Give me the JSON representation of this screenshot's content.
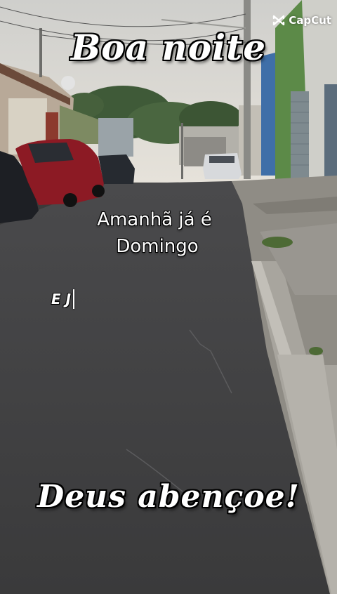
{
  "watermark": {
    "brand": "CapCut",
    "icon": "capcut-logo-icon"
  },
  "overlay": {
    "title_top": "Boa noite",
    "caption_line1": "Amanhã já é",
    "caption_line2": "Domingo",
    "typing_text": "E J",
    "title_bottom": "Deus abençoe!"
  },
  "colors": {
    "sky": "#d7d6d1",
    "asphalt": "#3d3d3e",
    "sidewalk": "#9a9790",
    "text": "#ffffff",
    "outline": "#000000"
  }
}
